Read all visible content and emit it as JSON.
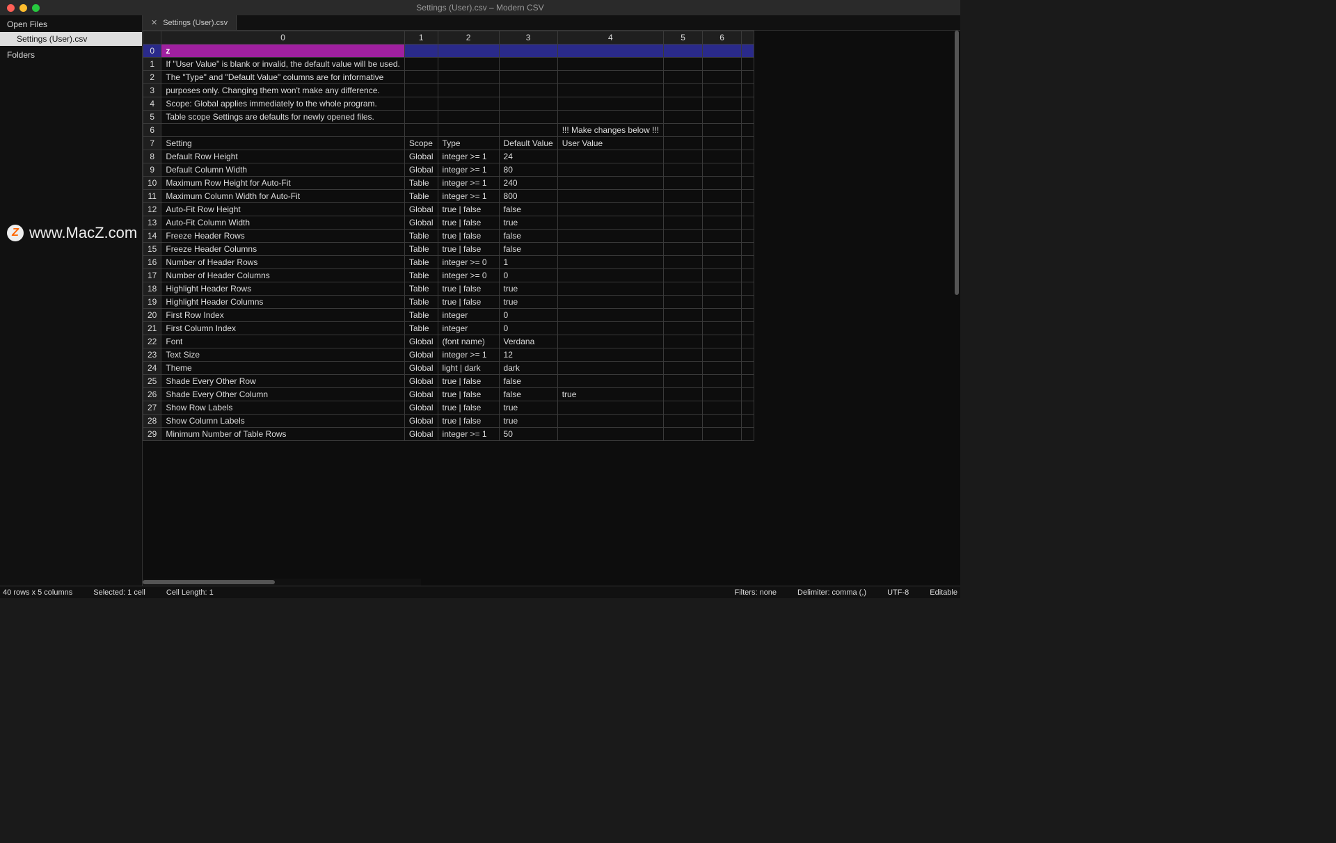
{
  "window": {
    "title": "Settings (User).csv – Modern CSV"
  },
  "sidebar": {
    "open_files_label": "Open Files",
    "open_file_item": "Settings (User).csv",
    "folders_label": "Folders"
  },
  "watermark": {
    "icon_letter": "Z",
    "text": "www.MacZ.com"
  },
  "tabs": [
    {
      "label": "Settings (User).csv",
      "close": "✕"
    }
  ],
  "columns": [
    "0",
    "1",
    "2",
    "3",
    "4",
    "5",
    "6",
    ""
  ],
  "rows": [
    {
      "n": "0",
      "c": [
        "z",
        "",
        "",
        "",
        "",
        "",
        ""
      ]
    },
    {
      "n": "1",
      "c": [
        "If \"User Value\" is blank or invalid, the default value will be used.",
        "",
        "",
        "",
        "",
        "",
        ""
      ]
    },
    {
      "n": "2",
      "c": [
        "The \"Type\" and \"Default Value\" columns are for informative",
        "",
        "",
        "",
        "",
        "",
        ""
      ]
    },
    {
      "n": "3",
      "c": [
        "purposes only. Changing them won't make any difference.",
        "",
        "",
        "",
        "",
        "",
        ""
      ]
    },
    {
      "n": "4",
      "c": [
        "Scope: Global applies immediately to the whole program.",
        "",
        "",
        "",
        "",
        "",
        ""
      ]
    },
    {
      "n": "5",
      "c": [
        "Table scope Settings are defaults for newly opened files.",
        "",
        "",
        "",
        "",
        "",
        ""
      ]
    },
    {
      "n": "6",
      "c": [
        "",
        "",
        "",
        "",
        "!!! Make changes below !!!",
        "",
        ""
      ]
    },
    {
      "n": "7",
      "c": [
        "Setting",
        "Scope",
        "Type",
        "Default Value",
        "User Value",
        "",
        ""
      ]
    },
    {
      "n": "8",
      "c": [
        "Default Row Height",
        "Global",
        "integer >= 1",
        "24",
        "",
        "",
        ""
      ]
    },
    {
      "n": "9",
      "c": [
        "Default Column Width",
        "Global",
        "integer >= 1",
        "80",
        "",
        "",
        ""
      ]
    },
    {
      "n": "10",
      "c": [
        "Maximum Row Height for Auto-Fit",
        "Table",
        "integer >= 1",
        "240",
        "",
        "",
        ""
      ]
    },
    {
      "n": "11",
      "c": [
        "Maximum Column Width for Auto-Fit",
        "Table",
        "integer >= 1",
        "800",
        "",
        "",
        ""
      ]
    },
    {
      "n": "12",
      "c": [
        "Auto-Fit Row Height",
        "Global",
        "true | false",
        "false",
        "",
        "",
        ""
      ]
    },
    {
      "n": "13",
      "c": [
        "Auto-Fit Column Width",
        "Global",
        "true | false",
        "true",
        "",
        "",
        ""
      ]
    },
    {
      "n": "14",
      "c": [
        "Freeze Header Rows",
        "Table",
        "true | false",
        "false",
        "",
        "",
        ""
      ]
    },
    {
      "n": "15",
      "c": [
        "Freeze Header Columns",
        "Table",
        "true | false",
        "false",
        "",
        "",
        ""
      ]
    },
    {
      "n": "16",
      "c": [
        "Number of Header Rows",
        "Table",
        "integer >= 0",
        "1",
        "",
        "",
        ""
      ]
    },
    {
      "n": "17",
      "c": [
        "Number of Header Columns",
        "Table",
        "integer >= 0",
        "0",
        "",
        "",
        ""
      ]
    },
    {
      "n": "18",
      "c": [
        "Highlight Header Rows",
        "Table",
        "true | false",
        "true",
        "",
        "",
        ""
      ]
    },
    {
      "n": "19",
      "c": [
        "Highlight Header Columns",
        "Table",
        "true | false",
        "true",
        "",
        "",
        ""
      ]
    },
    {
      "n": "20",
      "c": [
        "First Row Index",
        "Table",
        "integer",
        "0",
        "",
        "",
        ""
      ]
    },
    {
      "n": "21",
      "c": [
        "First Column Index",
        "Table",
        "integer",
        "0",
        "",
        "",
        ""
      ]
    },
    {
      "n": "22",
      "c": [
        "Font",
        "Global",
        "(font name)",
        "Verdana",
        "",
        "",
        ""
      ]
    },
    {
      "n": "23",
      "c": [
        "Text Size",
        "Global",
        "integer >= 1",
        "12",
        "",
        "",
        ""
      ]
    },
    {
      "n": "24",
      "c": [
        "Theme",
        "Global",
        "light | dark",
        "dark",
        "",
        "",
        ""
      ]
    },
    {
      "n": "25",
      "c": [
        "Shade Every Other Row",
        "Global",
        "true | false",
        "false",
        "",
        "",
        ""
      ]
    },
    {
      "n": "26",
      "c": [
        "Shade Every Other Column",
        "Global",
        "true | false",
        "false",
        "true",
        "",
        ""
      ]
    },
    {
      "n": "27",
      "c": [
        "Show Row Labels",
        "Global",
        "true | false",
        "true",
        "",
        "",
        ""
      ]
    },
    {
      "n": "28",
      "c": [
        "Show Column Labels",
        "Global",
        "true | false",
        "true",
        "",
        "",
        ""
      ]
    },
    {
      "n": "29",
      "c": [
        "Minimum Number of Table Rows",
        "Global",
        "integer >= 1",
        "50",
        "",
        "",
        ""
      ]
    }
  ],
  "status": {
    "dims": "40 rows x 5 columns",
    "selected": "Selected: 1 cell",
    "cell_length": "Cell Length: 1",
    "filters": "Filters: none",
    "delimiter": "Delimiter: comma (,)",
    "encoding": "UTF-8",
    "mode": "Editable"
  }
}
